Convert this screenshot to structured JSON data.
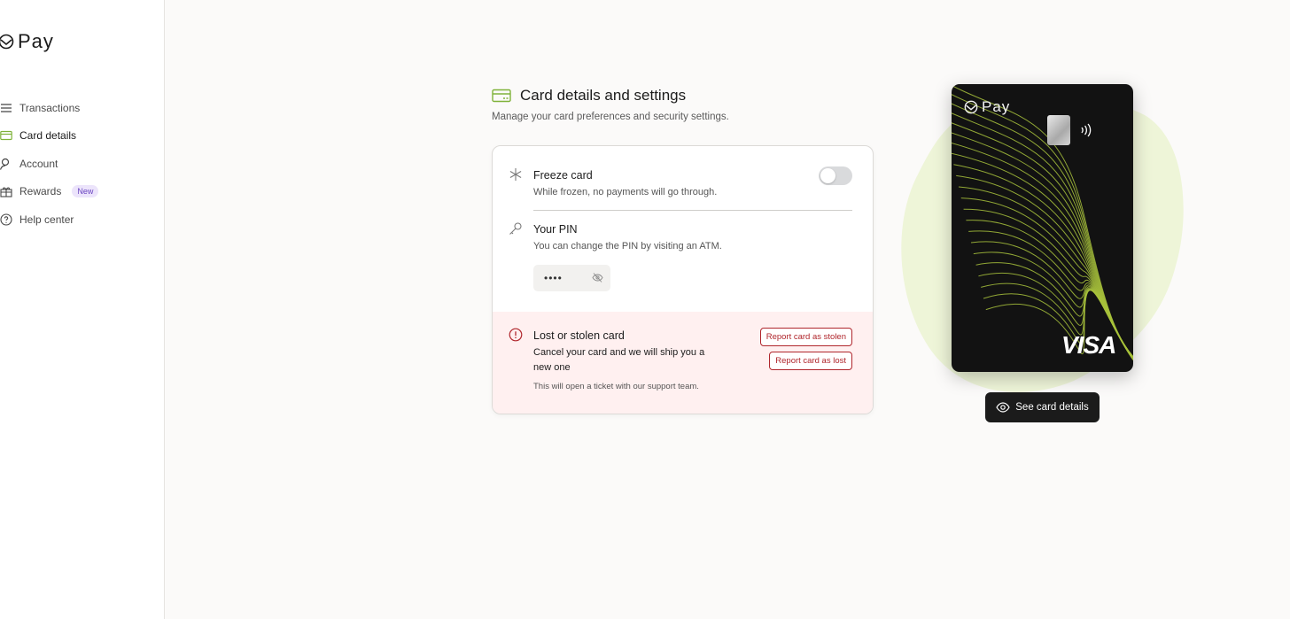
{
  "brand": {
    "name": "Pay"
  },
  "sidebar": {
    "items": [
      {
        "label": "Transactions",
        "icon": "list-icon"
      },
      {
        "label": "Card details",
        "icon": "card-icon",
        "active": true
      },
      {
        "label": "Account",
        "icon": "user-icon"
      },
      {
        "label": "Rewards",
        "icon": "gift-icon",
        "badge": "New"
      },
      {
        "label": "Help center",
        "icon": "help-icon"
      }
    ]
  },
  "page": {
    "title": "Card details and settings",
    "subtitle": "Manage your card preferences and security settings."
  },
  "settings": {
    "freeze": {
      "title": "Freeze card",
      "description": "While frozen, no payments will go through.",
      "enabled": false
    },
    "pin": {
      "title": "Your PIN",
      "description": "You can change the PIN by visiting an ATM.",
      "masked_value": "••••"
    },
    "lost": {
      "title": "Lost or stolen card",
      "description": "Cancel your card and we will ship you a new one",
      "note": "This will open a ticket with our support team.",
      "stolen_button": "Report card as stolen",
      "lost_button": "Report card as lost"
    }
  },
  "card": {
    "brand_text": "Pay",
    "network": "VISA",
    "see_details_label": "See card details"
  },
  "colors": {
    "accent_green": "#7fb23a",
    "danger": "#b0262c",
    "danger_bg": "#fff0f0",
    "blob": "#eef5d8"
  }
}
